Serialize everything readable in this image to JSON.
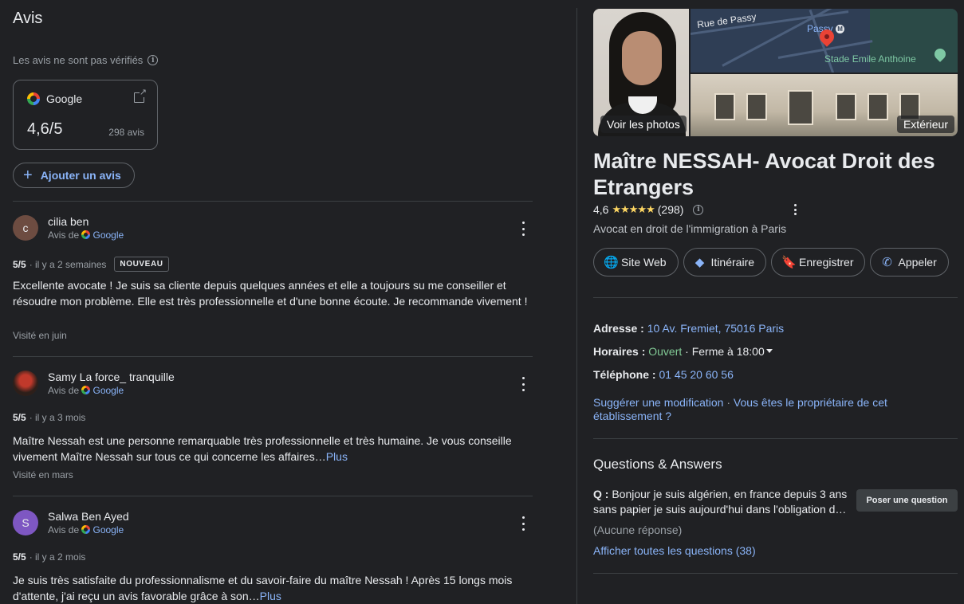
{
  "reviews_panel": {
    "title": "Avis",
    "unverified_note": "Les avis ne sont pas vérifiés",
    "google_card": {
      "name": "Google",
      "score": "4,6/5",
      "count": "298 avis"
    },
    "add_review_label": "Ajouter un avis",
    "reviews": [
      {
        "initial": "c",
        "name": "cilia ben",
        "source_prefix": "Avis de",
        "source": "Google",
        "score": "5/5",
        "time": "· il y a 2 semaines",
        "badge": "NOUVEAU",
        "text": "Excellente avocate ! Je suis sa cliente depuis quelques années et elle a toujours su me conseiller et résoudre mon problème. Elle est très professionnelle et d'une bonne écoute. Je recommande vivement !",
        "more": "",
        "visited": "Visité en juin"
      },
      {
        "initial": "",
        "name": "Samy La force_ tranquille",
        "source_prefix": "Avis de",
        "source": "Google",
        "score": "5/5",
        "time": "· il y a 3 mois",
        "badge": "",
        "text": "Maître Nessah est une personne remarquable très professionnelle et très humaine. Je vous conseille vivement Maître Nessah sur tous ce qui concerne les affaires…",
        "more": "Plus",
        "visited": "Visité en mars"
      },
      {
        "initial": "S",
        "name": "Salwa Ben Ayed",
        "source_prefix": "Avis de",
        "source": "Google",
        "score": "5/5",
        "time": "· il y a 2 mois",
        "badge": "",
        "text": "Je suis très satisfaite du professionnalisme et du savoir-faire du maître Nessah ! Après 15 longs mois d'attente, j'ai reçu un avis favorable grâce à son…",
        "more": "Plus",
        "visited": ""
      }
    ]
  },
  "business": {
    "photos_label": "Voir les photos",
    "exterior_label": "Extérieur",
    "map_labels": {
      "street": "Rue de Passy",
      "metro": "Passy",
      "metro_icon": "M",
      "stadium": "Stade Emile Anthoine"
    },
    "title": "Maître NESSAH- Avocat Droit des Etrangers",
    "rating": "4,6",
    "stars": "★★★★★",
    "review_count": "(298)",
    "category": "Avocat en droit de l'immigration à Paris",
    "actions": {
      "website": "Site Web",
      "directions": "Itinéraire",
      "save": "Enregistrer",
      "call": "Appeler"
    },
    "address": {
      "label": "Adresse :",
      "value": "10 Av. Fremiet, 75016 Paris"
    },
    "hours": {
      "label": "Horaires :",
      "status": "Ouvert",
      "closes": "· Ferme à 18:00"
    },
    "phone": {
      "label": "Téléphone :",
      "value": "01 45 20 60 56"
    },
    "suggest_edit": "Suggérer une modification",
    "separator": "·",
    "owner_claim": "Vous êtes le propriétaire de cet établissement ?",
    "qa": {
      "title": "Questions & Answers",
      "q_label": "Q :",
      "question": "Bonjour je suis algérien, en france depuis 3 ans sans papier je suis aujourd'hui dans l'obligation d…",
      "ask_button": "Poser une question",
      "no_answer": "(Aucune réponse)",
      "view_all": "Afficher toutes les questions (38)"
    }
  },
  "colors": {
    "background": "#202124",
    "link": "#8ab4f8",
    "open_status": "#81c995",
    "stars": "#fdd663"
  }
}
